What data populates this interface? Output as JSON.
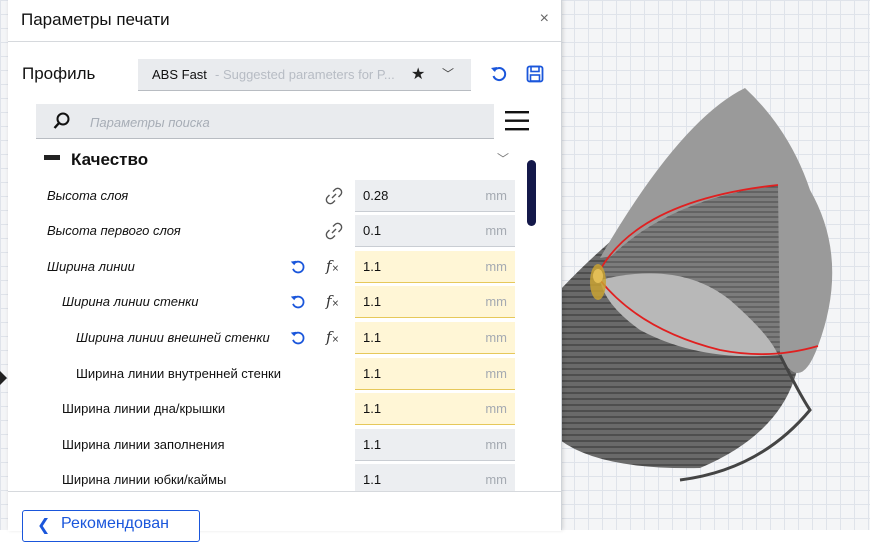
{
  "dialog": {
    "title": "Параметры печати",
    "close_label": "×"
  },
  "profile": {
    "label": "Профиль",
    "name": "ABS Fast",
    "description": " - Suggested parameters for P...",
    "reset_icon": "reset-icon",
    "save_icon": "save-icon"
  },
  "search": {
    "placeholder": "Параметры поиска",
    "value": ""
  },
  "section": {
    "title": "Качество"
  },
  "settings": [
    {
      "label": "Высота слоя",
      "value": "0.28",
      "unit": "mm",
      "indent": 0,
      "italic": true,
      "link": true,
      "reset": false,
      "fx": false,
      "changed": false
    },
    {
      "label": "Высота первого слоя",
      "value": "0.1",
      "unit": "mm",
      "indent": 0,
      "italic": true,
      "link": true,
      "reset": false,
      "fx": false,
      "changed": false
    },
    {
      "label": "Ширина линии",
      "value": "1.1",
      "unit": "mm",
      "indent": 0,
      "italic": true,
      "link": false,
      "reset": true,
      "fx": true,
      "changed": true
    },
    {
      "label": "Ширина линии стенки",
      "value": "1.1",
      "unit": "mm",
      "indent": 1,
      "italic": true,
      "link": false,
      "reset": true,
      "fx": true,
      "changed": true
    },
    {
      "label": "Ширина линии внешней стенки",
      "value": "1.1",
      "unit": "mm",
      "indent": 2,
      "italic": true,
      "link": false,
      "reset": true,
      "fx": true,
      "changed": true
    },
    {
      "label": "Ширина линии внутренней стенки",
      "value": "1.1",
      "unit": "mm",
      "indent": 2,
      "italic": false,
      "link": false,
      "reset": false,
      "fx": false,
      "changed": true
    },
    {
      "label": "Ширина линии дна/крышки",
      "value": "1.1",
      "unit": "mm",
      "indent": 1,
      "italic": false,
      "link": false,
      "reset": false,
      "fx": false,
      "changed": true
    },
    {
      "label": "Ширина линии заполнения",
      "value": "1.1",
      "unit": "mm",
      "indent": 1,
      "italic": false,
      "link": false,
      "reset": false,
      "fx": false,
      "changed": false
    },
    {
      "label": "Ширина линии юбки/каймы",
      "value": "1.1",
      "unit": "mm",
      "indent": 1,
      "italic": false,
      "link": false,
      "reset": false,
      "fx": false,
      "changed": false
    }
  ],
  "footer": {
    "recommended_label": "Рекомендован"
  },
  "colors": {
    "accent": "#1a56db",
    "changed_field": "#fff6d6",
    "scrollbar": "#14184a"
  }
}
